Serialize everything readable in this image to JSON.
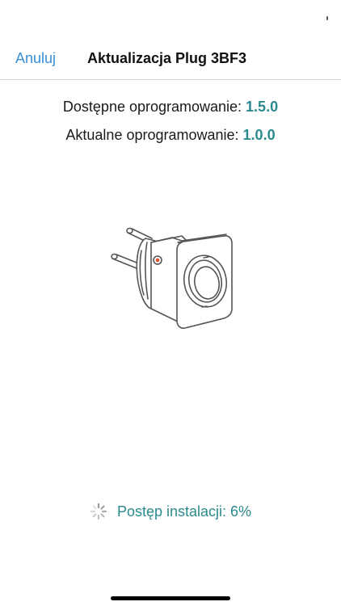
{
  "nav": {
    "cancel_label": "Anuluj",
    "title": "Aktualizacja Plug 3BF3"
  },
  "firmware": {
    "available_label": "Dostępne oprogramowanie: ",
    "available_version": "1.5.0",
    "current_label": "Aktualne oprogramowanie: ",
    "current_version": "1.0.0"
  },
  "progress": {
    "text": "Postęp instalacji: 6%",
    "percent": 6
  },
  "colors": {
    "accent_link": "#3a8fd6",
    "accent_teal": "#2b8a8e",
    "led": "#e0552b"
  },
  "icons": {
    "spinner": "loading-spinner-icon",
    "device": "smart-plug-icon"
  }
}
